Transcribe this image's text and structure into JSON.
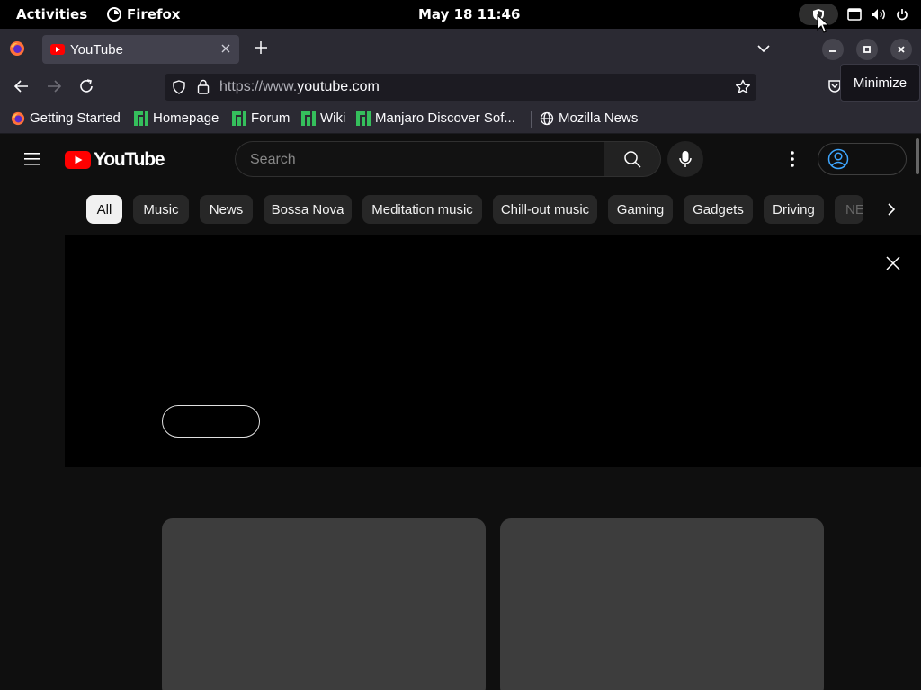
{
  "system": {
    "activities": "Activities",
    "app_name": "Firefox",
    "clock": "May 18  11:46"
  },
  "browser": {
    "tab_title": "YouTube",
    "url_prefix": "https://www.",
    "url_domain": "youtube.com",
    "tooltip": "Minimize"
  },
  "bookmarks": [
    {
      "label": "Getting Started"
    },
    {
      "label": "Homepage"
    },
    {
      "label": "Forum"
    },
    {
      "label": "Wiki"
    },
    {
      "label": "Manjaro Discover Sof..."
    },
    {
      "label": "Mozilla News"
    }
  ],
  "youtube": {
    "logo_text": "YouTube",
    "search_placeholder": "Search",
    "chips": [
      "All",
      "Music",
      "News",
      "Bossa Nova",
      "Meditation music",
      "Chill-out music",
      "Gaming",
      "Gadgets",
      "Driving",
      "NE"
    ]
  },
  "colors": {
    "youtube_red": "#ff0000",
    "manjaro_green": "#35bf5c",
    "link_blue": "#3ea6ff"
  }
}
